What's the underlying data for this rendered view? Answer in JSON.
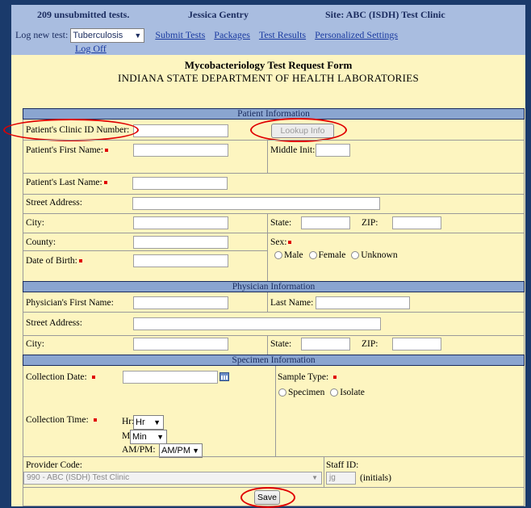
{
  "topbar": {
    "unsubmitted": "209 unsubmitted tests.",
    "user": "Jessica Gentry",
    "site": "Site: ABC (ISDH) Test Clinic",
    "log_new_test_label": "Log new test:",
    "test_type_value": "Tuberculosis",
    "links": [
      "Submit Tests",
      "Packages",
      "Test Results",
      "Personalized Settings"
    ],
    "logoff": "Log Off"
  },
  "form": {
    "title": "Mycobacteriology Test Request Form",
    "subtitle": "INDIANA STATE DEPARTMENT OF HEALTH LABORATORIES"
  },
  "patient": {
    "section": "Patient Information",
    "clinic_id": "Patient's Clinic ID Number:",
    "lookup": "Lookup Info",
    "first_name": "Patient's First Name:",
    "middle_init": "Middle Init:",
    "last_name": "Patient's Last Name:",
    "street": "Street Address:",
    "city": "City:",
    "state": "State:",
    "zip": "ZIP:",
    "county": "County:",
    "sex": "Sex:",
    "sex_options": [
      "Male",
      "Female",
      "Unknown"
    ],
    "dob": "Date of Birth:"
  },
  "physician": {
    "section": "Physician Information",
    "first_name": "Physician's First Name:",
    "last_name": "Last Name:",
    "street": "Street Address:",
    "city": "City:",
    "state": "State:",
    "zip": "ZIP:"
  },
  "specimen": {
    "section": "Specimen Information",
    "collection_date": "Collection Date:",
    "sample_type": "Sample Type:",
    "sample_options": [
      "Specimen",
      "Isolate"
    ],
    "collection_time": "Collection Time:",
    "hr_label": "Hr:",
    "hr_value": "Hr",
    "mi_label": "Mi:",
    "mi_value": "Min",
    "ampm_label": "AM/PM:",
    "ampm_value": "AM/PM"
  },
  "provider": {
    "label": "Provider Code:",
    "value": "990 - ABC (ISDH) Test Clinic",
    "staff_label": "Staff ID:",
    "staff_value": "jg",
    "initials": "(initials)"
  },
  "save": "Save"
}
